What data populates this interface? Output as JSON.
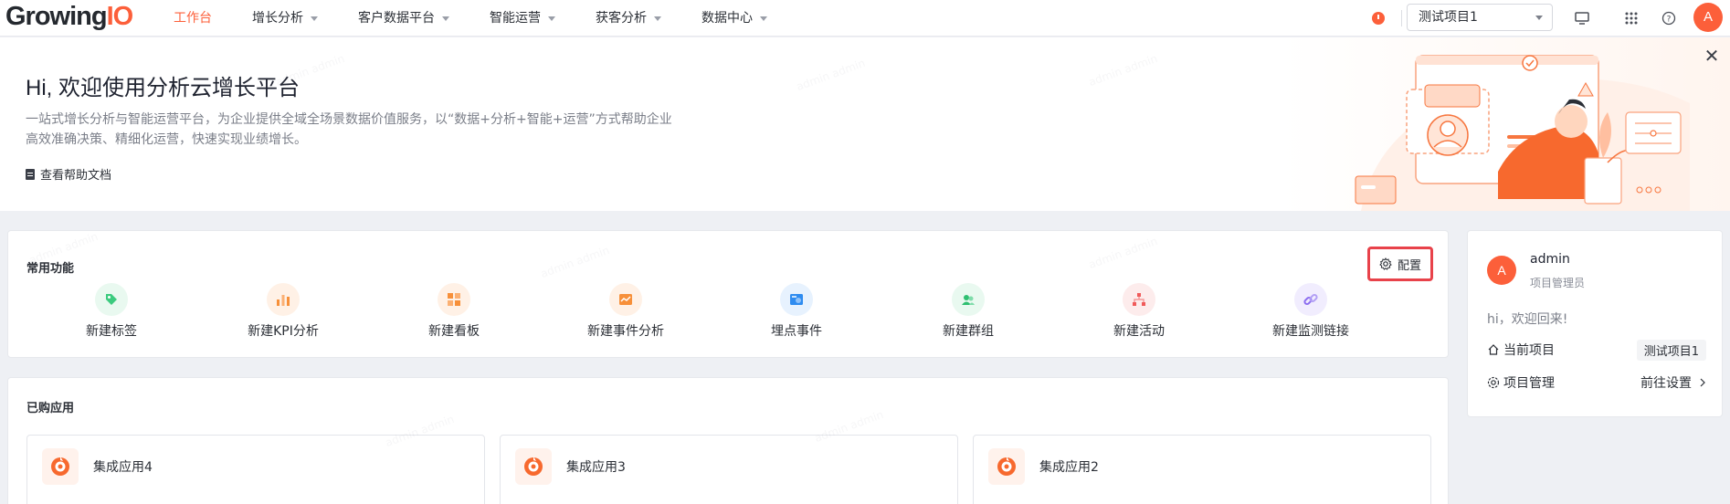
{
  "header": {
    "logo": {
      "main": "Growing",
      "accent": "IO"
    },
    "nav": [
      {
        "label": "工作台",
        "active": true,
        "dropdown": false
      },
      {
        "label": "增长分析",
        "active": false,
        "dropdown": true
      },
      {
        "label": "客户数据平台",
        "active": false,
        "dropdown": true
      },
      {
        "label": "智能运营",
        "active": false,
        "dropdown": true
      },
      {
        "label": "获客分析",
        "active": false,
        "dropdown": true
      },
      {
        "label": "数据中心",
        "active": false,
        "dropdown": true
      }
    ],
    "project_select": "测试项目1",
    "icons": [
      "clock-icon",
      "monitor-icon",
      "apps-grid-icon",
      "help-icon"
    ],
    "avatar_letter": "A",
    "accent_color": "#fc5f3a"
  },
  "hero": {
    "title": "Hi, 欢迎使用分析云增长平台",
    "description": "一站式增长分析与智能运营平台，为企业提供全域全场景数据价值服务，以“数据+分析+智能+运营”方式帮助企业高效准确决策、精细化运营，快速实现业绩增长。",
    "doc_link": "查看帮助文档"
  },
  "features": {
    "title": "常用功能",
    "config_label": "配置",
    "items": [
      {
        "label": "新建标签",
        "icon": "tag-icon",
        "color": "#3ccb7f",
        "bg": "#e9f9f0"
      },
      {
        "label": "新建KPI分析",
        "icon": "kpi-chart-icon",
        "color": "#f7903a",
        "bg": "#fff1e6"
      },
      {
        "label": "新建看板",
        "icon": "dashboard-icon",
        "color": "#f7903a",
        "bg": "#fff1e6"
      },
      {
        "label": "新建事件分析",
        "icon": "event-analysis-icon",
        "color": "#f7903a",
        "bg": "#fff1e6"
      },
      {
        "label": "埋点事件",
        "icon": "tracking-event-icon",
        "color": "#2f8cf0",
        "bg": "#e7f2fe"
      },
      {
        "label": "新建群组",
        "icon": "group-icon",
        "color": "#2fbf71",
        "bg": "#e9f9f0"
      },
      {
        "label": "新建活动",
        "icon": "activity-icon",
        "color": "#f05a5a",
        "bg": "#fdecec"
      },
      {
        "label": "新建监测链接",
        "icon": "link-icon",
        "color": "#8b6cf0",
        "bg": "#f1edfe"
      }
    ]
  },
  "apps": {
    "title": "已购应用",
    "items": [
      {
        "name": "集成应用4",
        "icon": "app-icon"
      },
      {
        "name": "集成应用3",
        "icon": "app-icon"
      },
      {
        "name": "集成应用2",
        "icon": "app-icon"
      }
    ]
  },
  "user": {
    "avatar_letter": "A",
    "name": "admin",
    "role": "项目管理员",
    "welcome": "hi，欢迎回来!",
    "current_project_label": "当前项目",
    "current_project_value": "测试项目1",
    "project_manage_label": "项目管理",
    "project_manage_link": "前往设置"
  },
  "watermark": "admin admin"
}
